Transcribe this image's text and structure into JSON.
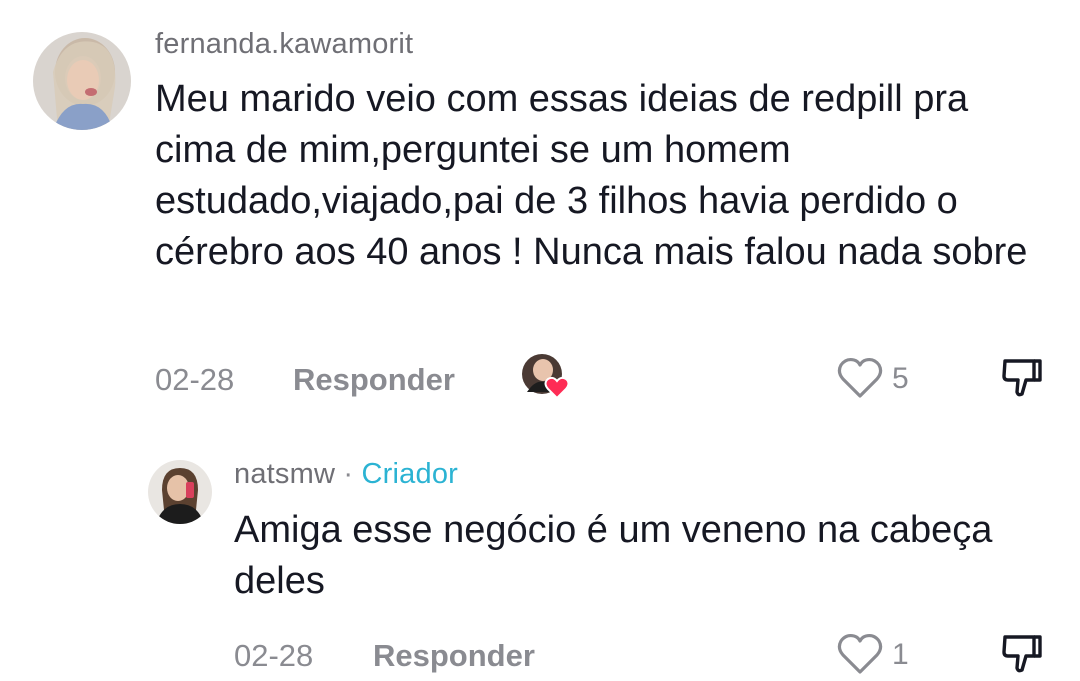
{
  "comments": [
    {
      "username": "fernanda.kawamorit",
      "text": "Meu marido veio com essas ideias de redpill pra cima de mim,perguntei se um homem estudado,viajado,pai de 3 filhos havia perdido o cérebro aos 40 anos ! Nunca mais falou nada sobre",
      "date": "02-28",
      "reply_label": "Responder",
      "likes": "5",
      "liked_by_creator": true
    }
  ],
  "replies": [
    {
      "username": "natsmw",
      "separator": "·",
      "badge": "Criador",
      "text": "Amiga esse negócio é um veneno na cabeça deles",
      "date": "02-28",
      "reply_label": "Responder",
      "likes": "1"
    }
  ],
  "colors": {
    "text": "#161823",
    "muted": "#8a8b91",
    "creator_badge": "#2bb3d3",
    "heart_badge": "#fe2c55"
  },
  "icons": [
    "heart-outline-icon",
    "dislike-icon",
    "creator-liked-heart-icon"
  ]
}
